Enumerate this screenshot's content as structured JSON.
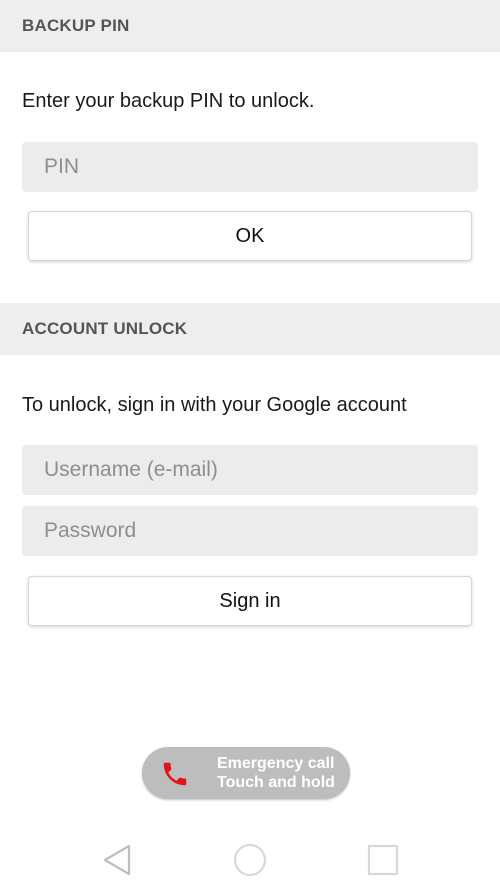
{
  "backup_pin": {
    "header": "BACKUP PIN",
    "instruction": "Enter your backup PIN to unlock.",
    "pin_placeholder": "PIN",
    "pin_value": "",
    "ok_label": "OK"
  },
  "account_unlock": {
    "header": "ACCOUNT UNLOCK",
    "instruction": "To unlock, sign in with your Google account",
    "username_placeholder": "Username (e-mail)",
    "username_value": "",
    "password_placeholder": "Password",
    "password_value": "",
    "sign_in_label": "Sign in"
  },
  "emergency": {
    "line1": "Emergency call",
    "line2": "Touch and hold",
    "icon": "phone-icon",
    "icon_color": "#e3121b"
  },
  "navbar": {
    "back_icon": "back-triangle-icon",
    "home_icon": "home-circle-icon",
    "recents_icon": "recents-square-icon"
  }
}
